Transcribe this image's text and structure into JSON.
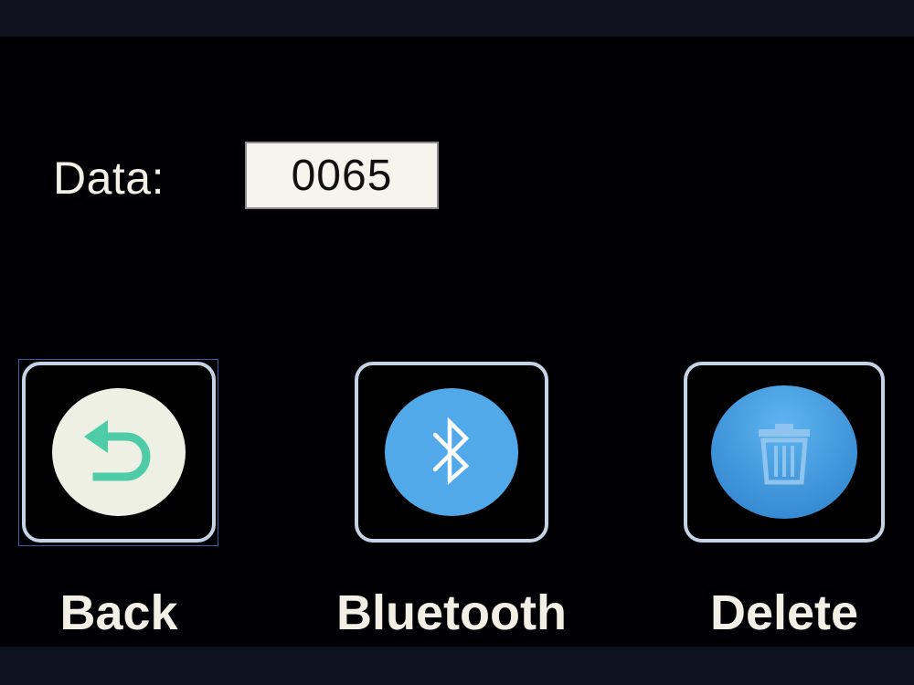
{
  "data_row": {
    "label": "Data:",
    "value": "0065"
  },
  "buttons": [
    {
      "label": "Back",
      "icon": "back-arrow-icon",
      "circle_color": "#eef0e4",
      "icon_color": "#4dcca7"
    },
    {
      "label": "Bluetooth",
      "icon": "bluetooth-icon",
      "circle_color": "#52a9ea",
      "icon_color": "#ffffff"
    },
    {
      "label": "Delete",
      "icon": "trash-icon",
      "circle_color": "#3a8fd6",
      "icon_color": "#8fc4ee"
    }
  ],
  "colors": {
    "background": "#000004",
    "text": "#f2efe4",
    "button_border": "#c5d3e6"
  }
}
